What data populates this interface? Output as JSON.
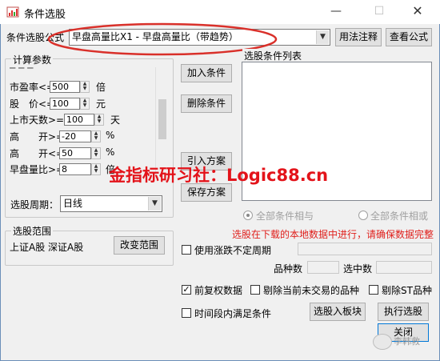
{
  "window": {
    "title": "条件选股"
  },
  "top": {
    "label": "条件选股公式",
    "formula_value": "早盘高量比X1 - 早盘高量比（带趋势）",
    "usage_button": "用法注释",
    "view_button": "查看公式"
  },
  "params": {
    "group_title": "计算参数",
    "rows": [
      {
        "label": "市盈率<=",
        "value": "500",
        "unit": "倍"
      },
      {
        "label": "股　价<=",
        "value": "100",
        "unit": "元"
      },
      {
        "label": "上市天数>=",
        "value": "100",
        "unit": "天"
      },
      {
        "label": "高　　开>=",
        "value": "-20",
        "unit": "%"
      },
      {
        "label": "高　　开<=",
        "value": "50",
        "unit": "%"
      },
      {
        "label": "早盘量比>=",
        "value": "8",
        "unit": "倍"
      }
    ],
    "period_label": "选股周期：",
    "period_value": "日线"
  },
  "scope": {
    "group_title": "选股范围",
    "value": "上证A股 深证A股",
    "change_button": "改变范围"
  },
  "actions": {
    "add": "加入条件",
    "delete": "删除条件",
    "import": "引入方案",
    "save": "保存方案"
  },
  "conditions": {
    "group_title": "选股条件列表",
    "radio_and": "全部条件相与",
    "radio_or": "全部条件相或"
  },
  "notice": "选股在下载的本地数据中进行，请确保数据完整",
  "notice_color": "#e0201c",
  "options": {
    "uncertain_period": "使用涨跌不定周期",
    "count_label": "品种数",
    "selected_label": "选中数",
    "adjust": "前复权数据",
    "exclude_untraded": "剔除当前未交易的品种",
    "exclude_st": "剔除ST品种",
    "time_range": "时间段内满足条件"
  },
  "buttons": {
    "to_block": "选股入板块",
    "execute": "执行选股",
    "close": "关闭"
  },
  "overlay": {
    "text": "金指标研习社：Logic88.cn",
    "color": "#e3131a"
  },
  "watermark": {
    "text": "李韩救"
  }
}
